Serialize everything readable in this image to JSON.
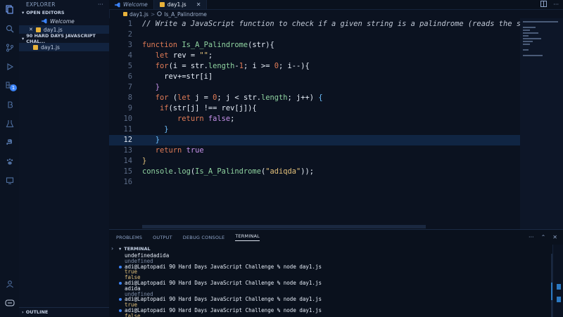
{
  "sidebar": {
    "title": "EXPLORER",
    "more": "···",
    "open_editors_label": "OPEN EDITORS",
    "open_editors": [
      {
        "label": "Welcome",
        "icon": "vscode-icon",
        "close": ""
      },
      {
        "label": "day1.js",
        "icon": "js-file-icon",
        "close": "✕"
      }
    ],
    "project_label": "90 HARD DAYS JAVASCRIPT CHAL...",
    "files": [
      {
        "label": "day1.js",
        "icon": "js-file-icon"
      }
    ],
    "outline_label": "OUTLINE"
  },
  "activity": {
    "badge": "1"
  },
  "tabs": [
    {
      "label": "Welcome",
      "icon": "vscode-icon"
    },
    {
      "label": "day1.js",
      "icon": "js-file-icon",
      "close": "✕"
    }
  ],
  "breadcrumb": {
    "file": "day1.js",
    "separator": ">",
    "symbol": "Is_A_Palindrome"
  },
  "editor": {
    "current_line": 12,
    "lines": [
      {
        "n": "1",
        "tokens": [
          {
            "t": "// Write a JavaScript function to check if a given string is a palindrome (reads the same forwards",
            "c": "c-com"
          }
        ]
      },
      {
        "n": "2",
        "tokens": []
      },
      {
        "n": "3",
        "tokens": [
          {
            "t": "function ",
            "c": "c-kw"
          },
          {
            "t": "Is_A_Palindrome",
            "c": "c-fn"
          },
          {
            "t": "(",
            "c": "c-brk"
          },
          {
            "t": "str",
            "c": "c-def"
          },
          {
            "t": "){",
            "c": "c-brk"
          }
        ]
      },
      {
        "n": "4",
        "tokens": [
          {
            "t": "   ",
            "c": "c-def"
          },
          {
            "t": "let ",
            "c": "c-kw"
          },
          {
            "t": "rev = ",
            "c": "c-def"
          },
          {
            "t": "\"\"",
            "c": "c-str"
          },
          {
            "t": ";",
            "c": "c-def"
          }
        ]
      },
      {
        "n": "5",
        "tokens": [
          {
            "t": "   ",
            "c": "c-def"
          },
          {
            "t": "for",
            "c": "c-kw"
          },
          {
            "t": "(i = str.",
            "c": "c-def"
          },
          {
            "t": "length",
            "c": "c-fn"
          },
          {
            "t": "-",
            "c": "c-def"
          },
          {
            "t": "1",
            "c": "c-num"
          },
          {
            "t": "; i >= ",
            "c": "c-def"
          },
          {
            "t": "0",
            "c": "c-num"
          },
          {
            "t": "; i--){",
            "c": "c-def"
          }
        ]
      },
      {
        "n": "6",
        "tokens": [
          {
            "t": "     rev+=str[i]",
            "c": "c-def"
          }
        ]
      },
      {
        "n": "7",
        "tokens": [
          {
            "t": "   }",
            "c": "c-bool"
          }
        ]
      },
      {
        "n": "8",
        "tokens": [
          {
            "t": "   ",
            "c": "c-def"
          },
          {
            "t": "for ",
            "c": "c-kw"
          },
          {
            "t": "(",
            "c": "c-def"
          },
          {
            "t": "let ",
            "c": "c-kw"
          },
          {
            "t": "j = ",
            "c": "c-def"
          },
          {
            "t": "0",
            "c": "c-num"
          },
          {
            "t": "; j < str.",
            "c": "c-def"
          },
          {
            "t": "length",
            "c": "c-fn"
          },
          {
            "t": "; j++) ",
            "c": "c-def"
          },
          {
            "t": "{",
            "c": "c-brk2"
          }
        ]
      },
      {
        "n": "9",
        "tokens": [
          {
            "t": "    ",
            "c": "c-def"
          },
          {
            "t": "if",
            "c": "c-kw"
          },
          {
            "t": "(str[j] !== rev[j]){",
            "c": "c-def"
          }
        ]
      },
      {
        "n": "10",
        "tokens": [
          {
            "t": "        ",
            "c": "c-def"
          },
          {
            "t": "return ",
            "c": "c-kw"
          },
          {
            "t": "false",
            "c": "c-bool"
          },
          {
            "t": ";",
            "c": "c-def"
          }
        ]
      },
      {
        "n": "11",
        "tokens": [
          {
            "t": "     }",
            "c": "c-brk2"
          }
        ]
      },
      {
        "n": "12",
        "tokens": [
          {
            "t": "   }",
            "c": "c-brk2"
          }
        ]
      },
      {
        "n": "13",
        "tokens": [
          {
            "t": "   ",
            "c": "c-def"
          },
          {
            "t": "return ",
            "c": "c-kw"
          },
          {
            "t": "true",
            "c": "c-bool"
          }
        ]
      },
      {
        "n": "14",
        "tokens": [
          {
            "t": "}",
            "c": "c-str"
          }
        ]
      },
      {
        "n": "15",
        "tokens": [
          {
            "t": "console",
            "c": "c-fn"
          },
          {
            "t": ".",
            "c": "c-def"
          },
          {
            "t": "log",
            "c": "c-fn"
          },
          {
            "t": "(",
            "c": "c-def"
          },
          {
            "t": "Is_A_Palindrome",
            "c": "c-fn"
          },
          {
            "t": "(",
            "c": "c-def"
          },
          {
            "t": "\"adiqda\"",
            "c": "c-str"
          },
          {
            "t": "));",
            "c": "c-def"
          }
        ]
      },
      {
        "n": "16",
        "tokens": []
      }
    ]
  },
  "panel": {
    "tabs": [
      {
        "label": "PROBLEMS",
        "active": false
      },
      {
        "label": "OUTPUT",
        "active": false
      },
      {
        "label": "DEBUG CONSOLE",
        "active": false
      },
      {
        "label": "TERMINAL",
        "active": true
      }
    ],
    "terminal_label": "TERMINAL",
    "lines": [
      {
        "text": "undefinedadida",
        "c": "t-def",
        "dot": false
      },
      {
        "text": "undefined",
        "c": "t-dim",
        "dot": false
      },
      {
        "text": "adi@Laptopadi 90 Hard Days JavaScript Challenge % node day1.js",
        "c": "t-cmd",
        "dot": true
      },
      {
        "text": "true",
        "c": "t-yel",
        "dot": false
      },
      {
        "text": "false",
        "c": "t-yel",
        "dot": false
      },
      {
        "text": "adi@Laptopadi 90 Hard Days JavaScript Challenge % node day1.js",
        "c": "t-cmd",
        "dot": true
      },
      {
        "text": "adida",
        "c": "t-def",
        "dot": false
      },
      {
        "text": "undefined",
        "c": "t-dim",
        "dot": false
      },
      {
        "text": "adi@Laptopadi 90 Hard Days JavaScript Challenge % node day1.js",
        "c": "t-cmd",
        "dot": true
      },
      {
        "text": "true",
        "c": "t-yel",
        "dot": false
      },
      {
        "text": "adi@Laptopadi 90 Hard Days JavaScript Challenge % node day1.js",
        "c": "t-cmd",
        "dot": true
      },
      {
        "text": "false",
        "c": "t-yel",
        "dot": false
      }
    ]
  },
  "colors": {
    "accent": "#3b82f6",
    "background": "#0b1220",
    "js_icon": "#e8b23a"
  }
}
